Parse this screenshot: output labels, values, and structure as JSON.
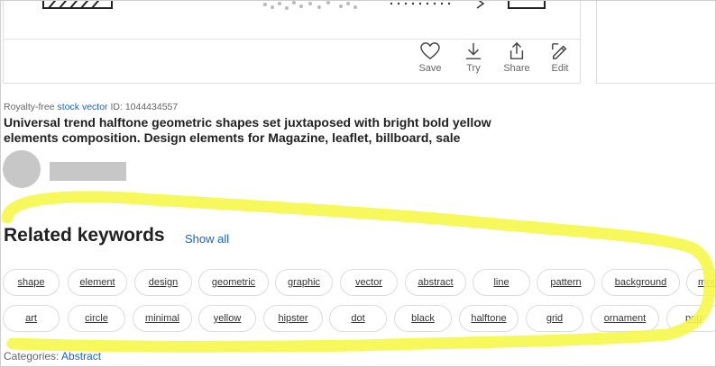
{
  "actions": [
    {
      "label": "Save",
      "icon": "heart-icon"
    },
    {
      "label": "Try",
      "icon": "download-icon"
    },
    {
      "label": "Share",
      "icon": "share-icon"
    },
    {
      "label": "Edit",
      "icon": "edit-icon"
    }
  ],
  "asset": {
    "meta_prefix": "Royalty-free",
    "meta_link": "stock vector",
    "meta_id_label": "ID:",
    "id": "1044434557",
    "title_line1": "Universal trend halftone geometric shapes set juxtaposed with bright bold yellow",
    "title_line2": "elements composition. Design elements for Magazine, leaflet, billboard, sale"
  },
  "related": {
    "heading": "Related keywords",
    "show_all": "Show all",
    "row1": [
      "shape",
      "element",
      "design",
      "geometric",
      "graphic",
      "vector",
      "abstract",
      "line",
      "pattern",
      "background",
      "mod"
    ],
    "row2": [
      "art",
      "circle",
      "minimal",
      "yellow",
      "hipster",
      "dot",
      "black",
      "halftone",
      "grid",
      "ornament",
      "pop"
    ]
  },
  "categories": {
    "label": "Categories:",
    "value": "Abstract"
  },
  "colors": {
    "link": "#1565c0",
    "highlight": "#f6f74a"
  }
}
